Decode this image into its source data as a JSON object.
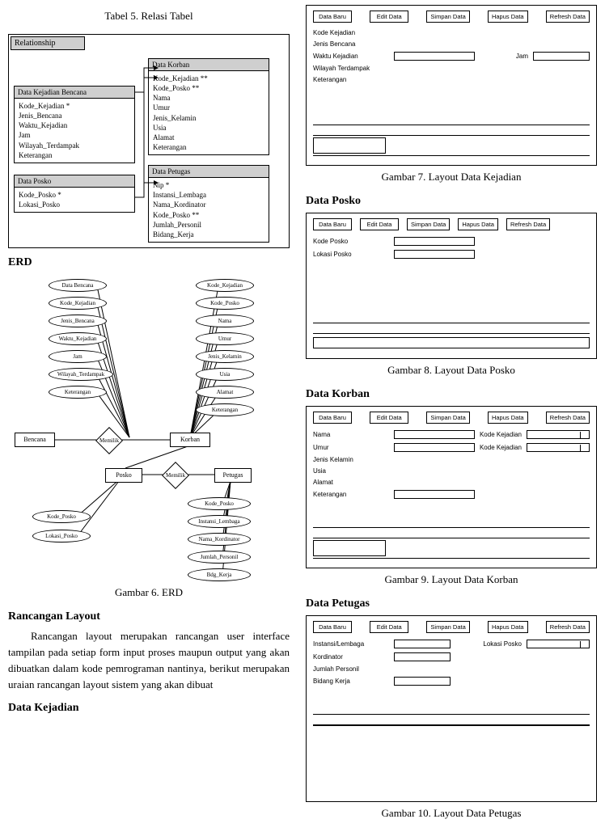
{
  "left": {
    "tabel5_caption": "Tabel 5. Relasi Tabel",
    "rel_title": "Relationship",
    "box_bencana": {
      "title": "Data Kejadian Bencana",
      "fields": [
        "Kode_Kejadian *",
        "Jenis_Bencana",
        "Waktu_Kejadian",
        "Jam",
        "Wilayah_Terdampak",
        "Keterangan"
      ]
    },
    "box_posko": {
      "title": "Data Posko",
      "fields": [
        "Kode_Posko *",
        "Lokasi_Posko"
      ]
    },
    "box_korban": {
      "title": "Data Korban",
      "fields": [
        "Kode_Kejadian **",
        "Kode_Posko **",
        "Nama",
        "Umur",
        "Jenis_Kelamin",
        "Usia",
        "Alamat",
        "Keterangan"
      ]
    },
    "box_petugas": {
      "title": "Data Petugas",
      "fields": [
        "Nip *",
        "Instansi_Lembaga",
        "Nama_Kordinator",
        "Kode_Posko **",
        "Jumlah_Personil",
        "Bidang_Kerja"
      ]
    },
    "erd_heading": "ERD",
    "erd": {
      "attrs_bencana": [
        "Data Bencana",
        "Kode_Kejadian",
        "Jenis_Bencana",
        "Waktu_Kejadian",
        "Jam",
        "Wilayah_Terdampak",
        "Keterangan"
      ],
      "attrs_korban": [
        "Kode_Kejadian",
        "Kode_Posko",
        "Nama",
        "Umur",
        "Jenis_Kelamin",
        "Usia",
        "Alamat",
        "Keterangan"
      ],
      "attrs_posko": [
        "Kode_Posko",
        "Lokasi_Posko"
      ],
      "attrs_petugas": [
        "Kode_Posko",
        "Instansi_Lembaga",
        "Nama_Kordinator",
        "Jumlah_Personil",
        "Bdg_Kerja"
      ],
      "entity_bencana": "Bencana",
      "entity_korban": "Korban",
      "entity_posko": "Posko",
      "entity_petugas": "Petugas",
      "rel_memilik1": "Memilik",
      "rel_memilik2": "Memilik"
    },
    "gambar6_caption": "Gambar 6. ERD",
    "rancangan_heading": "Rancangan Layout",
    "rancangan_para": "Rancangan layout merupakan rancangan user interface tampilan pada setiap form input proses maupun output yang akan dibuatkan dalam kode pemrograman nantinya, berikut merupakan uraian rancangan layout sistem yang akan dibuat",
    "data_kejadian_heading": "Data Kejadian"
  },
  "right": {
    "buttons": {
      "baru": "Data Baru",
      "edit": "Edit Data",
      "simpan": "Simpan Data",
      "hapus": "Hapus Data",
      "refresh": "Refresh Data"
    },
    "kejadian": {
      "labels": [
        "Kode Kejadian",
        "Jenis Bencana",
        "Waktu Kejadian",
        "Wilayah Terdampak",
        "Keterangan"
      ],
      "jam_label": "Jam"
    },
    "gambar7_caption": "Gambar 7. Layout Data Kejadian",
    "posko_heading": "Data Posko",
    "posko": {
      "labels": [
        "Kode Posko",
        "Lokasi Posko"
      ]
    },
    "gambar8_caption": "Gambar 8. Layout Data Posko",
    "korban_heading": "Data Korban",
    "korban": {
      "labels": [
        "Nama",
        "Umur",
        "Jenis Kelamin",
        "Usia",
        "Alamat",
        "Keterangan"
      ],
      "side_labels": [
        "Kode Kejadian",
        "Kode Kejadian"
      ]
    },
    "gambar9_caption": "Gambar 9. Layout Data Korban",
    "petugas_heading": "Data Petugas",
    "petugas": {
      "labels": [
        "Instansi/Lembaga",
        "Kordinator",
        "Jumlah Personil",
        "Bidang Kerja"
      ],
      "side_label": "Lokasi Posko"
    },
    "gambar10_caption": "Gambar 10. Layout Data Petugas"
  }
}
